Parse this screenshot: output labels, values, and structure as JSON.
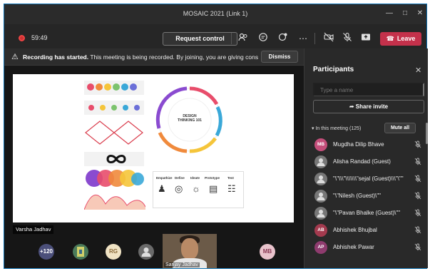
{
  "window": {
    "title": "MOSAIC 2021 (Link 1)"
  },
  "meeting": {
    "time": "59:49",
    "request_control": "Request control",
    "leave": "Leave"
  },
  "banner": {
    "bold": "Recording has started.",
    "text": "This meeting is being recorded. By joining, you are giving consent fo...",
    "dismiss": "Dismiss"
  },
  "stage": {
    "presenter_name": "Varsha Jadhav",
    "slide": {
      "ring_title": "DESIGN THINKING 101",
      "phases": [
        "Empathize",
        "Define",
        "Ideate",
        "Prototype",
        "Test"
      ]
    },
    "participants_bar": {
      "overflow": "+120",
      "rg": "RG",
      "mb": "MB",
      "video_name": "Sanjay Jadhav"
    }
  },
  "panel": {
    "title": "Participants",
    "search_placeholder": "Type a name",
    "share_invite": "Share invite",
    "in_meeting": "In this meeting (125)",
    "mute_all": "Mute all",
    "participants": [
      {
        "name": "Mugdha Dilip Bhave",
        "initials": "MB",
        "color": "#c44e7a"
      },
      {
        "name": "Alisha Randad (Guest)",
        "initials": "",
        "color": "#777777"
      },
      {
        "name": "\"\\\"\\\\\\\"\\\\\\\\\\\\\\\"sejal (Guest)\\\\\\\"\\\"\"",
        "initials": "",
        "color": "#777777"
      },
      {
        "name": "\"\\\"Nilesh (Guest)\\\"\"",
        "initials": "",
        "color": "#777777"
      },
      {
        "name": "\"\\\"Pavan Bhalke (Guest)\\\"\"",
        "initials": "",
        "color": "#777777"
      },
      {
        "name": "Abhishek Bhujbal",
        "initials": "AB",
        "color": "#a33a4e"
      },
      {
        "name": "Abhishek Pawar",
        "initials": "AP",
        "color": "#8e3b6e"
      }
    ]
  },
  "colors": {
    "leave": "#c4314b",
    "accent": "#0a6fb0"
  },
  "icons": [
    "people-icon",
    "chat-icon",
    "reactions-icon",
    "more-icon",
    "camera-off-icon",
    "mic-off-icon",
    "share-tray-icon",
    "phone-icon",
    "warning-icon",
    "close-icon",
    "share-icon",
    "mic-muted-icon"
  ]
}
